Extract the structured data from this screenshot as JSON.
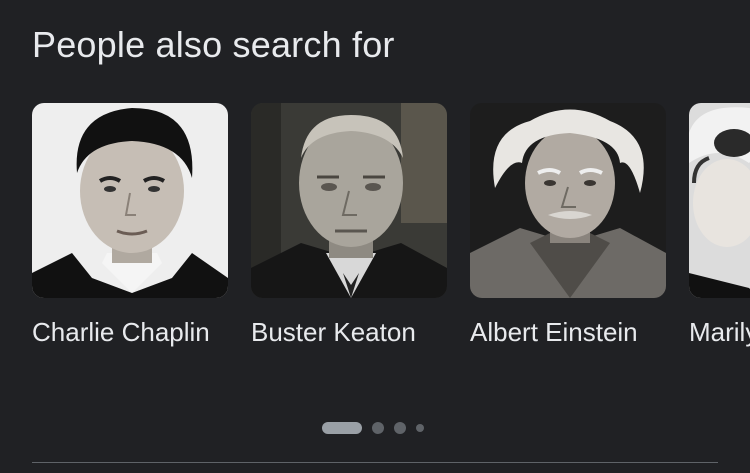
{
  "section": {
    "title": "People also search for"
  },
  "people": [
    {
      "name": "Charlie Chaplin",
      "image": "portrait-photo"
    },
    {
      "name": "Buster Keaton",
      "image": "portrait-photo"
    },
    {
      "name": "Albert Einstein",
      "image": "portrait-photo"
    },
    {
      "name": "Marilyn Monroe",
      "image": "portrait-photo"
    }
  ],
  "pagination": {
    "active_index": 0,
    "dot_count": 4
  },
  "colors": {
    "background": "#202124",
    "text": "#e8eaed",
    "indicator_active": "#9aa0a6",
    "indicator_inactive": "#5f6368"
  }
}
